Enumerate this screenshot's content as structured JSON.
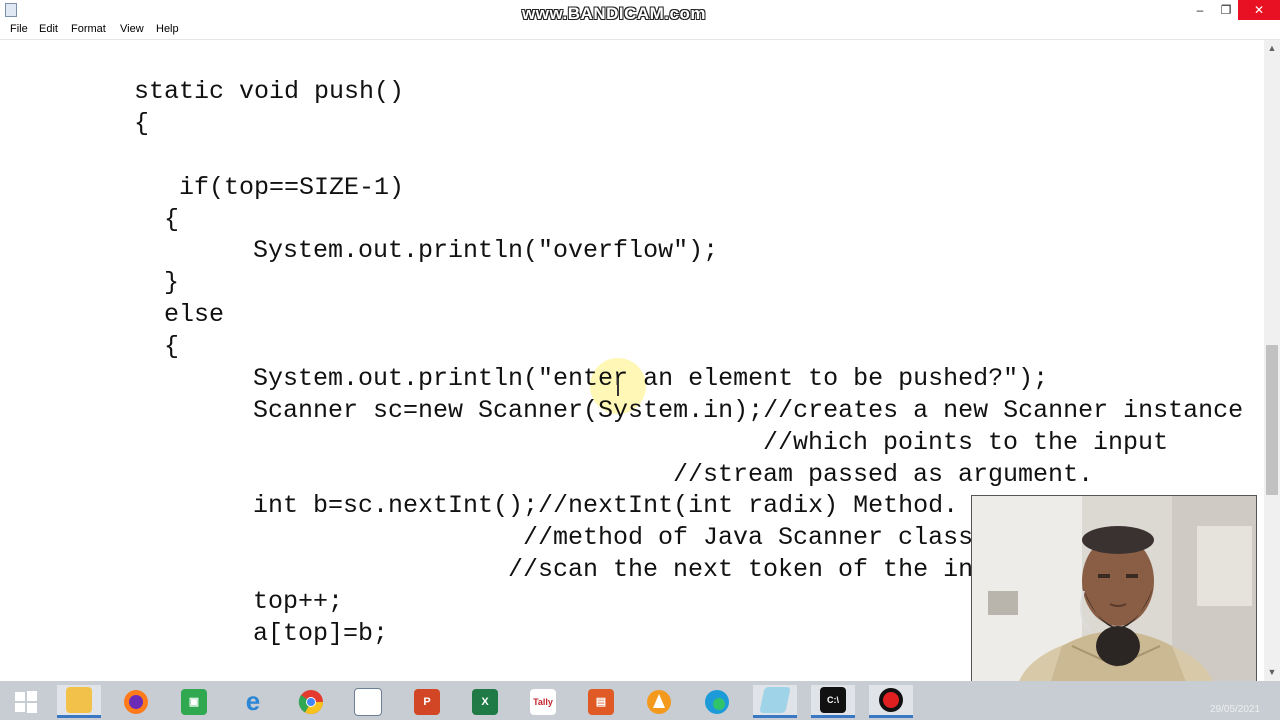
{
  "window": {
    "watermark": "www.BANDICAM.com",
    "minimize": "–",
    "maximize": "❐",
    "close": "✕"
  },
  "menu": {
    "file": "File",
    "edit": "Edit",
    "format": "Format",
    "view": "View",
    "help": "Help"
  },
  "code": {
    "lines": [
      "static void push()",
      "{",
      "if(top==SIZE-1)",
      "{",
      "System.out.println(\"overflow\");",
      "}",
      "else",
      "{",
      "System.out.println(\"enter an element to be pushed?\");",
      "Scanner sc=new Scanner(System.in);//creates a new Scanner instance",
      "//which points to the input",
      "//stream passed as argument.",
      "int b=sc.nextInt();//nextInt(int radix) Method.",
      "//method of Java Scanner class",
      "//scan the next token of the in",
      "top++;",
      "a[top]=b;"
    ]
  },
  "taskbar": {
    "icons": [
      "windows-start-icon",
      "file-explorer-icon",
      "firefox-icon",
      "store-icon",
      "internet-explorer-icon",
      "chrome-icon",
      "notepad-icon",
      "powerpoint-icon",
      "excel-icon",
      "tally-icon",
      "file-app-icon",
      "vlc-icon",
      "edge-icon",
      "notepad-active-icon",
      "command-prompt-icon",
      "recorder-icon"
    ],
    "date": "29/05/2021"
  }
}
